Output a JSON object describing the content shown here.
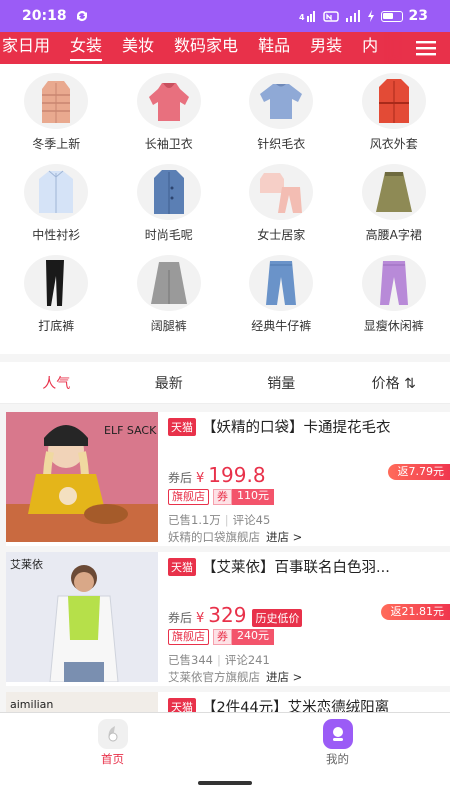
{
  "status": {
    "time": "20:18",
    "battery": "23"
  },
  "category_tabs": [
    "家日用",
    "女装",
    "美妆",
    "数码家电",
    "鞋品",
    "男装",
    "内"
  ],
  "active_tab": 1,
  "subcategories": [
    {
      "label": "冬季上新",
      "icon": "puffer-jacket"
    },
    {
      "label": "长袖卫衣",
      "icon": "hoodie"
    },
    {
      "label": "针织毛衣",
      "icon": "sweater"
    },
    {
      "label": "风衣外套",
      "icon": "trench-coat"
    },
    {
      "label": "中性衬衫",
      "icon": "shirt"
    },
    {
      "label": "时尚毛呢",
      "icon": "wool-coat"
    },
    {
      "label": "女士居家",
      "icon": "pajamas"
    },
    {
      "label": "高腰A字裙",
      "icon": "a-line-skirt"
    },
    {
      "label": "打底裤",
      "icon": "leggings"
    },
    {
      "label": "阔腿裤",
      "icon": "wide-leg-pants"
    },
    {
      "label": "经典牛仔裤",
      "icon": "jeans"
    },
    {
      "label": "显瘦休闲裤",
      "icon": "casual-pants"
    }
  ],
  "sort": {
    "popular": "人气",
    "newest": "最新",
    "sales": "销量",
    "price": "价格",
    "price_icon": "⇅"
  },
  "products": [
    {
      "platform": "天猫",
      "title": "【妖精的口袋】卡通提花毛衣",
      "after_label": "券后",
      "currency": "¥",
      "price": "199.8",
      "rebate": "返7.79元",
      "shop_flag": "旗舰店",
      "coupon_key": "券",
      "coupon_value": "110元",
      "sold": "已售1.1万",
      "reviews": "评论45",
      "shop": "妖精的口袋旗舰店",
      "enter": "进店 >",
      "brand_art": "ELF SACK 妖精的口袋"
    },
    {
      "platform": "天猫",
      "title": "【艾莱依】百事联名白色羽...",
      "after_label": "券后",
      "currency": "¥",
      "price": "329",
      "history_tag": "历史低价",
      "rebate": "返21.81元",
      "shop_flag": "旗舰店",
      "coupon_key": "券",
      "coupon_value": "240元",
      "sold": "已售344",
      "reviews": "评论241",
      "shop": "艾莱依官方旗舰店",
      "enter": "进店 >",
      "brand_art": "艾莱依"
    },
    {
      "platform": "天猫",
      "title": "【2件44元】艾米恋德绒阳离",
      "brand_art": "aimilian"
    }
  ],
  "tabbar": {
    "home": "首页",
    "mine": "我的"
  },
  "colors": {
    "accent": "#e8314a",
    "status_bar": "#9b5cf6"
  }
}
